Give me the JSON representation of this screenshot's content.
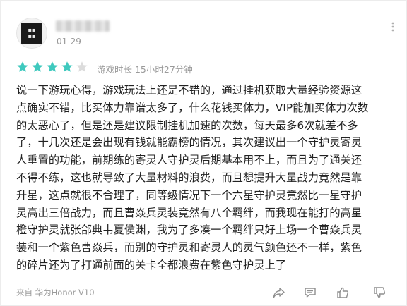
{
  "review_card": {
    "date": "01-29",
    "rating": {
      "value": 4,
      "max": 5,
      "filled_color": "#3fc9be",
      "empty_color": "#dcdcdc"
    },
    "playtime_text": "游戏时长 15小时27分钟",
    "body_lines": [
      "说一下游玩心得，游戏玩法上还是不错的，通过挂机获取大量经验资源这",
      "点确实不错，比买体力靠谱太多了，什么花钱买体力，VIP能加买体力次数",
      "的太恶心了，但是还是建议限制挂机加速的次数，每天最多6次就差不多",
      "了，十几次还是会出现有钱就能霸榜的情况，其次建议出一个守护灵寄灵",
      "人重置的功能，前期练的寄灵人守护灵后期基本用不上，而且为了通关还",
      "不得不练，这也就导致了大量材料的浪费，而且想提升大量战力竟然是靠",
      "升星，这点就很不合理了，同等级情况下一个六星守护灵竟然比一星守护",
      "灵高出三倍战力，而且曹焱兵灵装竟然有八个羁绊，而我现在能打的高星",
      "橙守护灵就张郃典韦夏侯渊，我为了多凑一个羁绊只好上场一个曹焱兵灵",
      "装和一个紫色曹焱兵，而别的守护灵和寄灵人的灵气颜色还不一样，紫色",
      "的碎片还为了打通前面的关卡全都浪费在紫色守护灵上了"
    ],
    "source_text": "来自 华为Honor V10",
    "icons": {
      "more": "more-vertical-icon",
      "share": "share-icon",
      "comment": "comment-icon",
      "like": "thumbs-up-icon",
      "dislike": "thumbs-down-icon"
    }
  }
}
